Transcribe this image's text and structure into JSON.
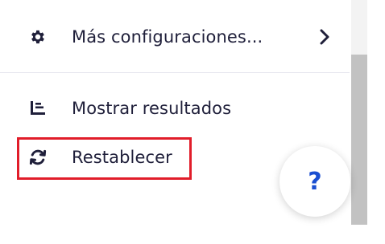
{
  "menu": {
    "items": [
      {
        "label": "Más configuraciones...",
        "icon": "gear-icon",
        "has_submenu": true
      },
      {
        "label": "Mostrar resultados",
        "icon": "results-list-icon"
      },
      {
        "label": "Restablecer",
        "icon": "refresh-icon"
      }
    ]
  },
  "help": {
    "label": "?"
  },
  "colors": {
    "text": "#1f1f3a",
    "highlight": "#e11d2a",
    "help_accent": "#1a4fd1",
    "scroll_thumb": "#c2c2c2"
  }
}
